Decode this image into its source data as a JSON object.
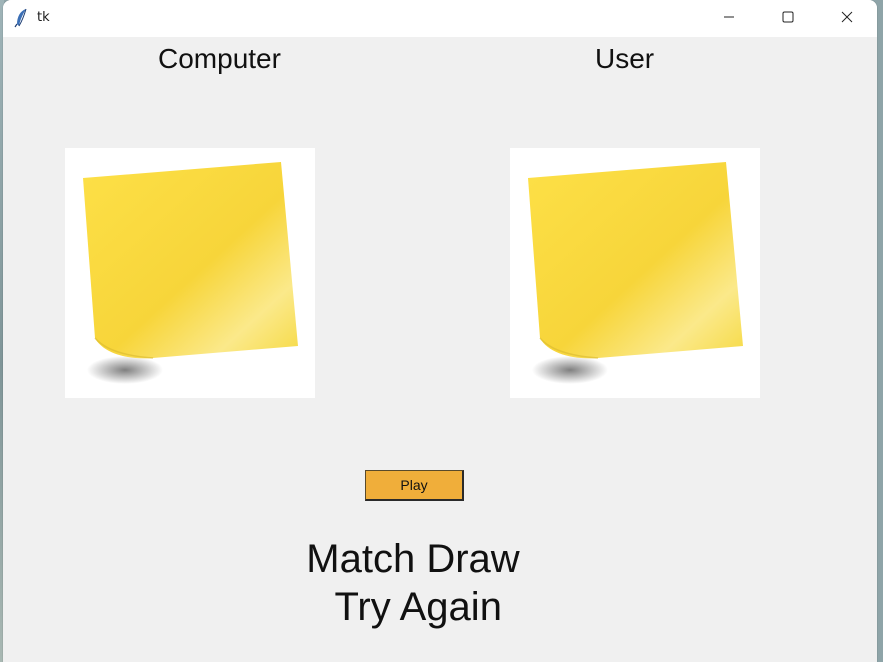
{
  "window": {
    "title": "tk",
    "controls": {
      "minimize_icon": "minimize-icon",
      "maximize_icon": "maximize-icon",
      "close_icon": "close-icon"
    }
  },
  "players": {
    "computer_label": "Computer",
    "user_label": "User"
  },
  "cards": {
    "computer_choice_icon": "sticky-note-paper-icon",
    "user_choice_icon": "sticky-note-paper-icon",
    "note_color": "#f9dc3f"
  },
  "actions": {
    "play_label": "Play",
    "play_color": "#f0ae3a"
  },
  "result": {
    "line1": "Match Draw",
    "line2": " Try Again"
  }
}
